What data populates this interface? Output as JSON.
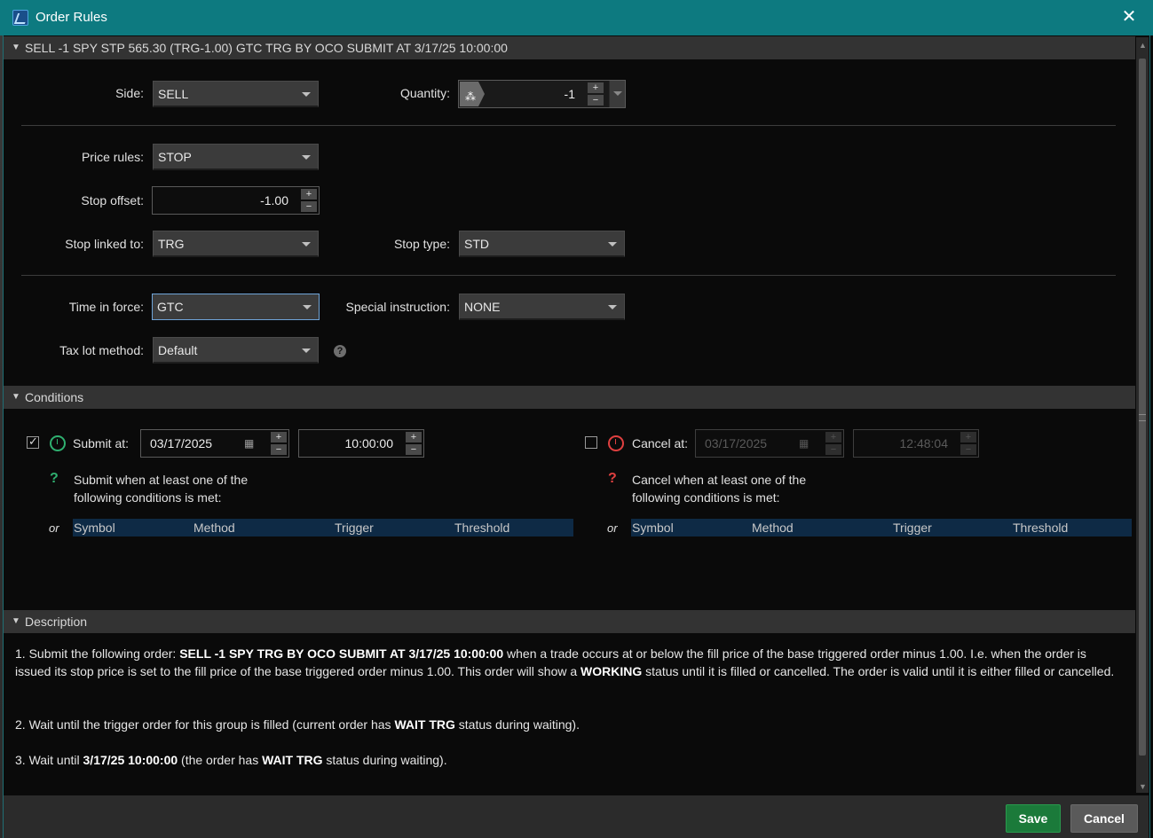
{
  "window": {
    "title": "Order Rules"
  },
  "order_header": "SELL -1 SPY STP 565.30 (TRG-1.00) GTC TRG BY OCO SUBMIT AT 3/17/25 10:00:00",
  "form": {
    "side_label": "Side:",
    "side_value": "SELL",
    "quantity_label": "Quantity:",
    "quantity_value": "-1",
    "price_rules_label": "Price rules:",
    "price_rules_value": "STOP",
    "stop_offset_label": "Stop offset:",
    "stop_offset_value": "-1.00",
    "stop_linked_label": "Stop linked to:",
    "stop_linked_value": "TRG",
    "stop_type_label": "Stop type:",
    "stop_type_value": "STD",
    "tif_label": "Time in force:",
    "tif_value": "GTC",
    "special_label": "Special instruction:",
    "special_value": "NONE",
    "tax_lot_label": "Tax lot method:",
    "tax_lot_value": "Default",
    "help_symbol": "?"
  },
  "conditions": {
    "header": "Conditions",
    "submit_label": "Submit at:",
    "submit_date": "03/17/2025",
    "submit_time": "10:00:00",
    "submit_checked": true,
    "submit_text_1": "Submit when at least one of the",
    "submit_text_2": "following conditions is met:",
    "cancel_label": "Cancel at:",
    "cancel_date": "03/17/2025",
    "cancel_time": "12:48:04",
    "cancel_checked": false,
    "cancel_text_1": "Cancel when at least one of the",
    "cancel_text_2": "following conditions is met:",
    "or_label": "or",
    "columns": [
      "Symbol",
      "Method",
      "Trigger",
      "Threshold"
    ]
  },
  "description": {
    "header": "Description",
    "p1_pre": "1. Submit the following order: ",
    "p1_bold": "SELL -1 SPY TRG BY OCO SUBMIT AT 3/17/25 10:00:00",
    "p1_mid": " when a trade occurs at or below the fill price of the base triggered order minus 1.00. I.e. when the order is issued its stop price is set to the fill price of the base triggered order minus 1.00. This order will show a ",
    "p1_bold2": "WORKING",
    "p1_post": " status until it is filled or cancelled. The order is valid until it is either filled or cancelled.",
    "p2_pre": "2. Wait until the trigger order for this group is filled (current order has ",
    "p2_bold": "WAIT TRG",
    "p2_post": " status during waiting).",
    "p3_pre": "3. Wait until ",
    "p3_bold": "3/17/25 10:00:00",
    "p3_mid": " (the order has ",
    "p3_bold2": "WAIT TRG",
    "p3_post": " status during waiting)."
  },
  "footer": {
    "save_label": "Save",
    "cancel_label": "Cancel"
  },
  "icons": {
    "close": "close-icon",
    "app": "app-icon",
    "calendar": "calendar-icon",
    "clock": "clock-icon"
  },
  "colors": {
    "titlebar": "#0d7a80",
    "save": "#1b7a3a",
    "header_row": "#0e2a45"
  }
}
